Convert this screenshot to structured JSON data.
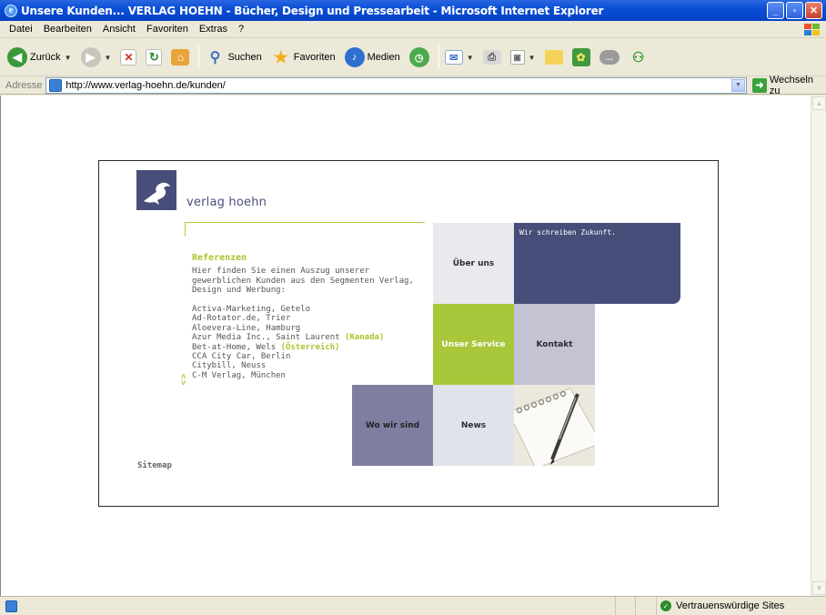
{
  "window": {
    "title": "Unsere Kunden... VERLAG HOEHN - Bücher, Design und Pressearbeit - Microsoft Internet Explorer"
  },
  "menu": [
    "Datei",
    "Bearbeiten",
    "Ansicht",
    "Favoriten",
    "Extras",
    "?"
  ],
  "toolbar": {
    "back_label": "Zurück",
    "search_label": "Suchen",
    "favorites_label": "Favoriten",
    "media_label": "Medien"
  },
  "address": {
    "label": "Adresse",
    "url": "http://www.verlag-hoehn.de/kunden/",
    "go_label": "Wechseln zu"
  },
  "page": {
    "brand": "verlag hoehn",
    "ref_title": "Referenzen",
    "ref_intro": "Hier finden Sie einen Auszug unserer gewerblichen Kunden aus den Segmenten Verlag, Design und Werbung:",
    "ref_items": [
      {
        "text": "Activa-Marketing, Getelo",
        "note": ""
      },
      {
        "text": "Ad-Rotator.de, Trier",
        "note": ""
      },
      {
        "text": "Aloevera-Line, Hamburg",
        "note": ""
      },
      {
        "text": "Azur Media Inc., Saint Laurent ",
        "note": "(Kanada)"
      },
      {
        "text": "Bet-at-Home, Wels ",
        "note": "(Österreich)"
      },
      {
        "text": "CCA City Car, Berlin",
        "note": ""
      },
      {
        "text": "Citybill, Neuss",
        "note": ""
      },
      {
        "text": "C-M Verlag, München",
        "note": ""
      }
    ],
    "sitemap": "Sitemap",
    "tiles": {
      "ueber_uns": "Über uns",
      "zukunft": "Wir schreiben Zukunft.",
      "service": "Unser Service",
      "kontakt": "Kontakt",
      "wo": "Wo wir sind",
      "news": "News"
    },
    "colors": {
      "accent_green": "#a8c73a",
      "brand_blue": "#474e79"
    }
  },
  "status": {
    "zone": "Vertrauenswürdige Sites"
  }
}
